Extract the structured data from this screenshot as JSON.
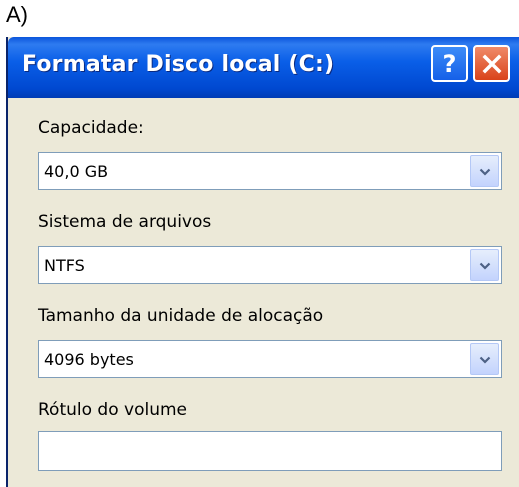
{
  "figure_label": "A)",
  "window": {
    "title": "Formatar Disco local (C:)",
    "help_button_glyph": "?",
    "close_icon": "close-x-icon",
    "titlebar_color": "#0A5FE8",
    "body_color": "#ECE9D8"
  },
  "fields": {
    "capacity": {
      "label": "Capacidade:",
      "value": "40,0 GB"
    },
    "filesystem": {
      "label": "Sistema de arquivos",
      "value": "NTFS"
    },
    "allocation": {
      "label": "Tamanho da unidade de alocação",
      "value": "4096 bytes"
    },
    "volume_label": {
      "label": "Rótulo do volume",
      "value": ""
    }
  },
  "icons": {
    "dropdown": "chevron-down-icon"
  }
}
